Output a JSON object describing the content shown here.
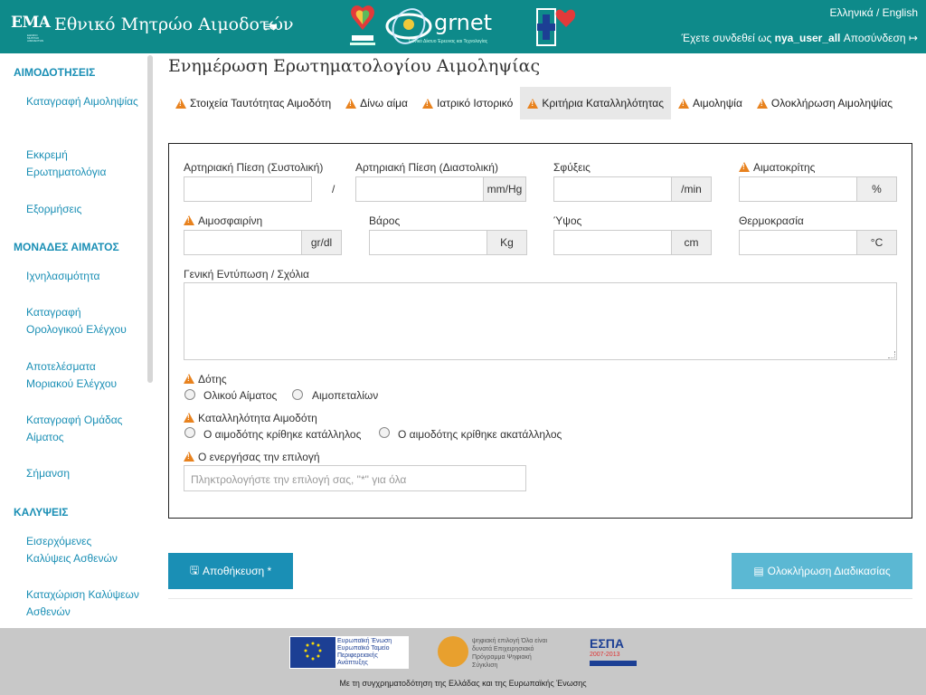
{
  "header": {
    "logo_text": "EMA",
    "logo_subtext": "ΕΘΝΙΚΟ ΜΗΤΡΩΟ ΑΙΜΟΔΟΤΩΝ",
    "title": "Εθνικό Μητρώο Αιμοδοτών",
    "menu_icon": "≡▾",
    "grnet_text": "grnet",
    "grnet_subtext": "Εθνικό Δίκτυο Έρευνας και Τεχνολογίας",
    "lang_label": "Ελληνικά / English",
    "user_prefix": "Έχετε συνδεθεί ως",
    "username": "nya_user_all",
    "logout_label": "Αποσύνδεση"
  },
  "sidebar": {
    "sections": [
      {
        "title": "ΑΙΜΟΔΟΤΗΣΕΙΣ",
        "items": [
          "Καταγραφή Αιμοληψίας",
          "Εκκρεμή Ερωτηματολόγια",
          "Εξορμήσεις"
        ]
      },
      {
        "title": "ΜΟΝΑΔΕΣ ΑΙΜΑΤΟΣ",
        "items": [
          "Ιχνηλασιμότητα",
          "Καταγραφή Ορολογικού Ελέγχου",
          "Αποτελέσματα Μοριακού Ελέγχου",
          "Καταγραφή Ομάδας Αίματος",
          "Σήμανση"
        ]
      },
      {
        "title": "ΚΑΛΥΨΕΙΣ",
        "items": [
          "Εισερχόμενες Καλύψεις Ασθενών",
          "Καταχώριση Καλύψεων Ασθενών"
        ]
      }
    ]
  },
  "page": {
    "title": "Ενημέρωση Ερωτηματολογίου Αιμοληψίας"
  },
  "tabs": [
    {
      "label": "Στοιχεία Ταυτότητας Αιμοδότη",
      "warn": true,
      "active": false
    },
    {
      "label": "Δίνω αίμα",
      "warn": true,
      "active": false
    },
    {
      "label": "Ιατρικό Ιστορικό",
      "warn": true,
      "active": false
    },
    {
      "label": "Κριτήρια Καταλληλότητας",
      "warn": true,
      "active": true
    },
    {
      "label": "Αιμοληψία",
      "warn": true,
      "active": false
    },
    {
      "label": "Ολοκλήρωση Αιμοληψίας",
      "warn": true,
      "active": false
    }
  ],
  "form": {
    "systolic_label": "Αρτηριακή Πίεση (Συστολική)",
    "systolic_value": "",
    "slash": "/",
    "diastolic_label": "Αρτηριακή Πίεση (Διαστολική)",
    "diastolic_value": "",
    "pressure_unit": "mm/Hg",
    "pulse_label": "Σφύξεις",
    "pulse_value": "",
    "pulse_unit": "/min",
    "hematocrit_label": "Αιματοκρίτης",
    "hematocrit_value": "",
    "hematocrit_unit": "%",
    "hemoglobin_label": "Αιμοσφαιρίνη",
    "hemoglobin_value": "",
    "hemoglobin_unit": "gr/dl",
    "weight_label": "Βάρος",
    "weight_value": "",
    "weight_unit": "Kg",
    "height_label": "Ύψος",
    "height_value": "",
    "height_unit": "cm",
    "temperature_label": "Θερμοκρασία",
    "temperature_value": "",
    "temperature_unit": "°C",
    "comments_label": "Γενική Εντύπωση / Σχόλια",
    "comments_value": "",
    "donor_label": "Δότης",
    "donor_options": [
      "Ολικού Αίματος",
      "Αιμοπεταλίων"
    ],
    "eligibility_label": "Καταλληλότητα Αιμοδότη",
    "eligibility_options": [
      "Ο αιμοδότης κρίθηκε κατάλληλος",
      "Ο αιμοδότης κρίθηκε ακατάλληλος"
    ],
    "actor_label": "Ο ενεργήσας την επιλογή",
    "actor_placeholder": "Πληκτρολογήστε την επιλογή σας, \"*\" για όλα"
  },
  "buttons": {
    "save_label": "Αποθήκευση *",
    "complete_label": "Ολοκλήρωση Διαδικασίας"
  },
  "footer": {
    "eu_text": "Ευρωπαϊκή Ένωση Ευρωπαϊκό Ταμείο Περιφερειακής Ανάπτυξης",
    "digital_text": "ψηφιακή επιλογή Όλα είναι δυνατά Επιχειρησιακό Πρόγραμμα Ψηφιακή Σύγκλιση",
    "espa_text": "ΕΣΠΑ",
    "espa_sub": "2007-2013",
    "cofunding_text": "Με τη συγχρηματοδότηση της Ελλάδας και της Ευρωπαϊκής Ένωσης"
  },
  "colors": {
    "header_bg": "#0e8a8a",
    "accent": "#1a8fb5",
    "warning": "#e8821e",
    "complete_button": "#5bb8d3",
    "footer_bg": "#c8c8c8"
  }
}
